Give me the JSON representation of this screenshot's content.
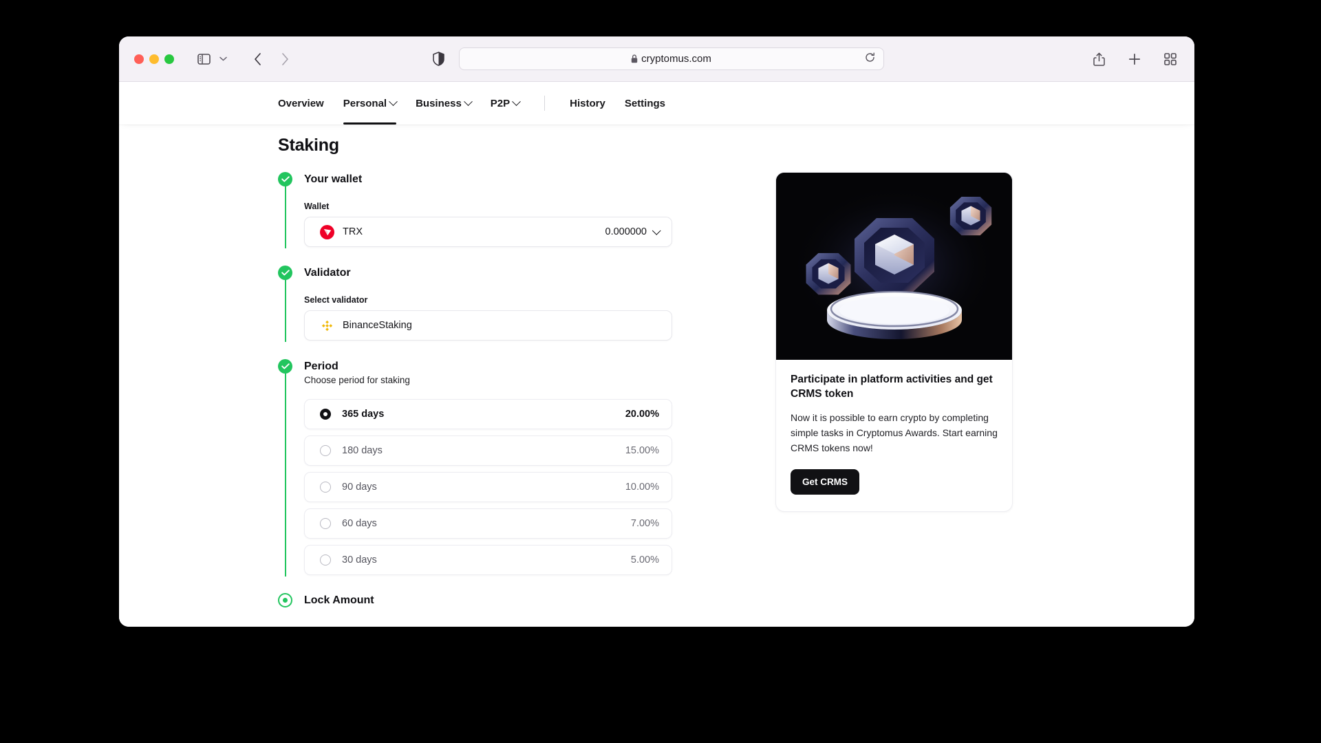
{
  "browser": {
    "url": "cryptomus.com",
    "lock_icon": "lock-icon",
    "reload_icon": "reload-icon",
    "shield_icon": "shield-privacy-icon",
    "sidebar_icon": "sidebar-toggle-icon",
    "back_icon": "back-arrow-icon",
    "forward_icon": "forward-arrow-icon",
    "share_icon": "share-icon",
    "new_tab_icon": "plus-icon",
    "tab_overview_icon": "tab-grid-icon"
  },
  "site_nav": {
    "items": [
      {
        "label": "Overview",
        "has_caret": false,
        "active": false
      },
      {
        "label": "Personal",
        "has_caret": true,
        "active": true
      },
      {
        "label": "Business",
        "has_caret": true,
        "active": false
      },
      {
        "label": "P2P",
        "has_caret": true,
        "active": false
      },
      {
        "label": "History",
        "has_caret": false,
        "active": false
      },
      {
        "label": "Settings",
        "has_caret": false,
        "active": false
      }
    ]
  },
  "page": {
    "title": "Staking"
  },
  "steps": {
    "wallet": {
      "title": "Your wallet",
      "field_label": "Wallet",
      "coin": "TRX",
      "coin_icon": "tron-trx-icon",
      "balance": "0.000000",
      "state": "complete"
    },
    "validator": {
      "title": "Validator",
      "field_label": "Select validator",
      "selected": "BinanceStaking",
      "icon": "binance-icon",
      "state": "complete"
    },
    "period": {
      "title": "Period",
      "subtitle": "Choose period for staking",
      "state": "complete",
      "options": [
        {
          "label": "365 days",
          "rate": "20.00%",
          "selected": true
        },
        {
          "label": "180 days",
          "rate": "15.00%",
          "selected": false
        },
        {
          "label": "90 days",
          "rate": "10.00%",
          "selected": false
        },
        {
          "label": "60 days",
          "rate": "7.00%",
          "selected": false
        },
        {
          "label": "30 days",
          "rate": "5.00%",
          "selected": false
        }
      ]
    },
    "lock_amount": {
      "title": "Lock Amount",
      "state": "current"
    }
  },
  "promo": {
    "title": "Participate in platform activities and get CRMS token",
    "description": "Now it is possible to earn crypto by completing simple tasks in Cryptomus Awards. Start earning CRMS tokens now!",
    "button_label": "Get CRMS",
    "art_alt": "crms-token-3d-illustration"
  },
  "colors": {
    "step_green": "#22c55e",
    "trx_red": "#ef0027",
    "binance_amber": "#f0b90b",
    "accent_black": "#111114"
  }
}
